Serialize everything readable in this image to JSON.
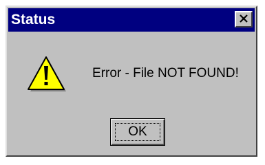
{
  "window": {
    "title": "Status",
    "close_icon": "close-icon"
  },
  "content": {
    "icon": "warning-icon",
    "message": "Error - File NOT FOUND!"
  },
  "buttons": {
    "ok_label": "OK"
  },
  "colors": {
    "titlebar": "#000080",
    "dialog_face": "#c0c0c0",
    "warning_fill": "#ffff00"
  }
}
